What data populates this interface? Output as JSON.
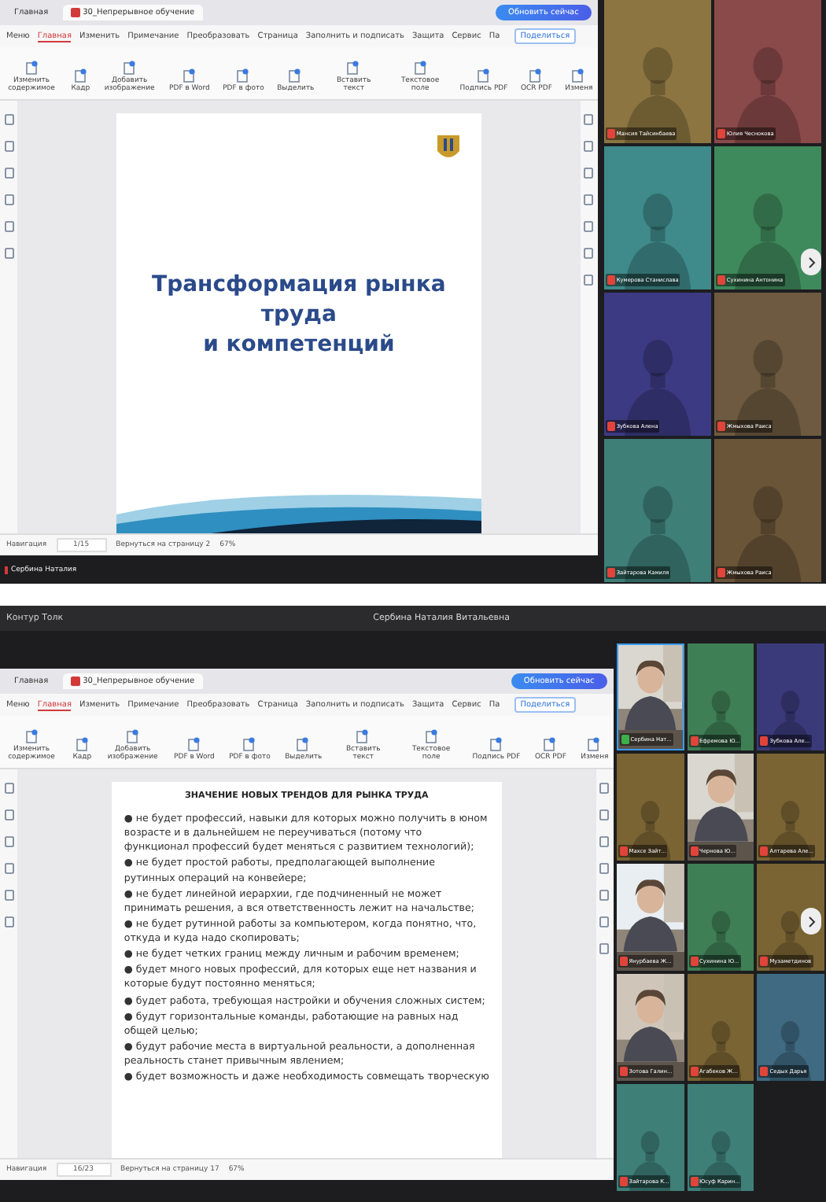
{
  "panels": [
    {
      "presenter_tag": "Сербина Наталия",
      "editor": {
        "tabs": [
          {
            "label": "Главная",
            "selected": false
          },
          {
            "label": "30_Непрерывное обучение",
            "selected": true
          }
        ],
        "update_button": "Обновить сейчас",
        "menu_label": "Меню",
        "menu": [
          {
            "label": "Главная",
            "selected": true
          },
          {
            "label": "Изменить",
            "selected": false
          },
          {
            "label": "Примечание",
            "selected": false
          },
          {
            "label": "Преобразовать",
            "selected": false
          },
          {
            "label": "Страница",
            "selected": false
          },
          {
            "label": "Заполнить и подписать",
            "selected": false
          },
          {
            "label": "Защита",
            "selected": false
          },
          {
            "label": "Сервис",
            "selected": false
          },
          {
            "label": "Па",
            "selected": false
          }
        ],
        "share_button": "Поделиться",
        "tools": [
          "Изменить содержимое",
          "Кадр",
          "Добавить изображение",
          "PDF в Word",
          "PDF в фото",
          "Выделить",
          "Вставить текст",
          "Текстовое поле",
          "Подпись PDF",
          "OCR PDF",
          "Изменя"
        ],
        "slide": {
          "kind": "title",
          "title_lines": [
            "Трансформация рынка",
            "труда",
            "и компетенций"
          ]
        },
        "nav_label": "Навигация",
        "page": "1/15",
        "back_link": "Вернуться на страницу 2",
        "zoom": "67%"
      },
      "participants": [
        {
          "name": "Мансия Тайсинбаева",
          "kind": "avatar",
          "color": "#8c7541",
          "muted": true,
          "speaking": false
        },
        {
          "name": "Юлия Чеснокова",
          "kind": "avatar",
          "color": "#8a4a4a",
          "muted": true,
          "speaking": false
        },
        {
          "name": "Кумерова Станислава",
          "kind": "avatar",
          "color": "#3f8a8a",
          "muted": true,
          "speaking": false
        },
        {
          "name": "Сухинина Антонина",
          "kind": "avatar",
          "color": "#3f8a5c",
          "muted": true,
          "speaking": false
        },
        {
          "name": "Зубкова Алена",
          "kind": "avatar",
          "color": "#3c3a82",
          "muted": true,
          "speaking": false
        },
        {
          "name": "Жмыхова Раиса",
          "kind": "avatar",
          "color": "#6e5a40",
          "muted": true,
          "speaking": false
        },
        {
          "name": "Зайтарова Камиля",
          "kind": "avatar",
          "color": "#3e7f78",
          "muted": true,
          "speaking": false
        },
        {
          "name": "Жмыхова Раиса",
          "kind": "avatar",
          "color": "#6b5538",
          "muted": true,
          "speaking": false
        }
      ]
    },
    {
      "app_title": "Контур Толк",
      "presenter": "Сербина Наталия Витальевна",
      "editor": {
        "tabs": [
          {
            "label": "Главная",
            "selected": false
          },
          {
            "label": "30_Непрерывное обучение",
            "selected": true
          }
        ],
        "update_button": "Обновить сейчас",
        "menu_label": "Меню",
        "menu": [
          {
            "label": "Главная",
            "selected": true
          },
          {
            "label": "Изменить",
            "selected": false
          },
          {
            "label": "Примечание",
            "selected": false
          },
          {
            "label": "Преобразовать",
            "selected": false
          },
          {
            "label": "Страница",
            "selected": false
          },
          {
            "label": "Заполнить и подписать",
            "selected": false
          },
          {
            "label": "Защита",
            "selected": false
          },
          {
            "label": "Сервис",
            "selected": false
          },
          {
            "label": "Па",
            "selected": false
          }
        ],
        "share_button": "Поделиться",
        "tools": [
          "Изменить содержимое",
          "Кадр",
          "Добавить изображение",
          "PDF в Word",
          "PDF в фото",
          "Выделить",
          "Вставить текст",
          "Текстовое поле",
          "Подпись PDF",
          "OCR PDF",
          "Изменя"
        ],
        "slide": {
          "kind": "text",
          "heading": "ЗНАЧЕНИЕ НОВЫХ ТРЕНДОВ ДЛЯ РЫНКА ТРУДА",
          "bullet": "●",
          "items": [
            "не будет профессий, навыки для которых можно получить в юном возрасте и в дальнейшем не переучиваться (потому что функционал профессий будет меняться с развитием технологий);",
            "не будет простой работы, предполагающей выполнение рутинных операций на конвейере;",
            "не будет линейной иерархии, где подчиненный не может принимать решения, а вся ответственность лежит на начальстве;",
            "не будет рутинной работы за компьютером, когда понятно, что, откуда и куда надо скопировать;",
            "не будет четких границ между личным и рабочим временем;",
            "будет много новых профессий, для которых еще нет названия и которые будут постоянно меняться;",
            "будет работа, требующая настройки и обучения сложных систем;",
            "будут горизонтальные команды, работающие на равных над общей целью;",
            "будут рабочие места в виртуальной реальности, а дополненная реальность станет привычным явлением;",
            "будет возможность и даже необходимость совмещать творческую"
          ]
        },
        "nav_label": "Навигация",
        "page": "16/23",
        "back_link": "Вернуться на страницу 17",
        "zoom": "67%"
      },
      "participants": [
        {
          "name": "Сербина Нат...",
          "kind": "picture",
          "muted": false,
          "speaking": true
        },
        {
          "name": "Ефремова Ю...",
          "kind": "avatar",
          "color": "#3f7f55",
          "muted": true,
          "speaking": false
        },
        {
          "name": "Зубкова Але...",
          "kind": "avatar",
          "color": "#3a3a7a",
          "muted": true,
          "speaking": false
        },
        {
          "name": "Махсе Зайт...",
          "kind": "avatar",
          "color": "#7a6434",
          "muted": true,
          "speaking": false
        },
        {
          "name": "Чернова Ю...",
          "kind": "picture",
          "muted": true,
          "speaking": false
        },
        {
          "name": "Алтарева Але...",
          "kind": "avatar",
          "color": "#7a6434",
          "muted": true,
          "speaking": false
        },
        {
          "name": "Янурбаева Ж...",
          "kind": "picture",
          "muted": true,
          "speaking": false
        },
        {
          "name": "Сухинина Ю...",
          "kind": "avatar",
          "color": "#3f7f55",
          "muted": true,
          "speaking": false
        },
        {
          "name": "Музаметдинов",
          "kind": "avatar",
          "color": "#7a6434",
          "muted": true,
          "speaking": false
        },
        {
          "name": "Зотова Галин...",
          "kind": "picture",
          "muted": true,
          "speaking": false
        },
        {
          "name": "Агабеков Ж...",
          "kind": "avatar",
          "color": "#7a6434",
          "muted": true,
          "speaking": false
        },
        {
          "name": "Седых Дарья",
          "kind": "avatar",
          "color": "#3f6a82",
          "muted": true,
          "speaking": false
        },
        {
          "name": "Зайтарова К...",
          "kind": "avatar",
          "color": "#3e7f78",
          "muted": true,
          "speaking": false
        },
        {
          "name": "Юсуф Карин...",
          "kind": "avatar",
          "color": "#3e7f78",
          "muted": true,
          "speaking": false
        }
      ]
    }
  ]
}
